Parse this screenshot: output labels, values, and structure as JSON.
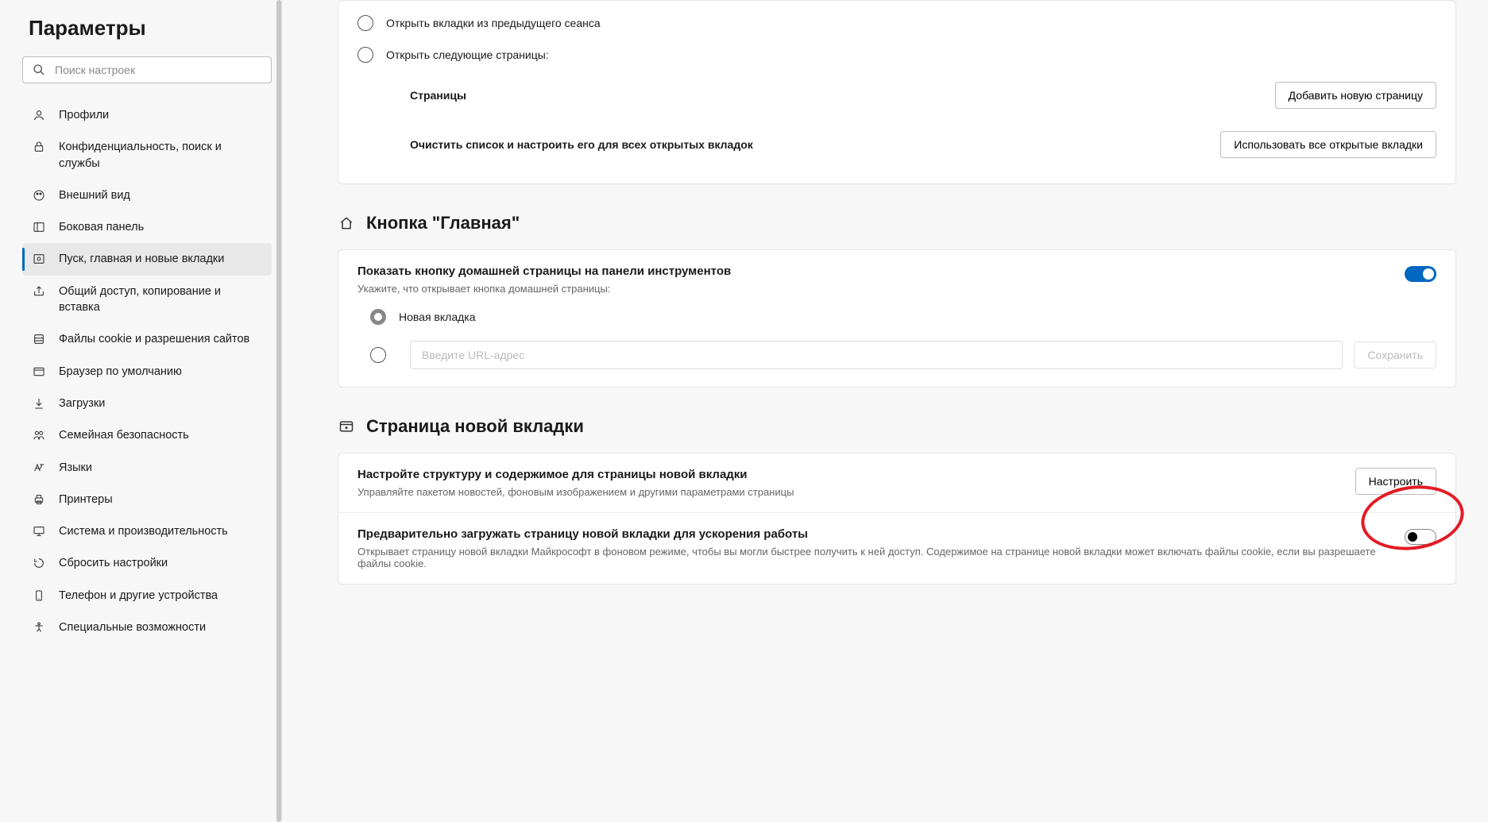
{
  "sidebar": {
    "title": "Параметры",
    "search_placeholder": "Поиск настроек",
    "items": [
      {
        "label": "Профили"
      },
      {
        "label": "Конфиденциальность, поиск и службы"
      },
      {
        "label": "Внешний вид"
      },
      {
        "label": "Боковая панель"
      },
      {
        "label": "Пуск, главная и новые вкладки"
      },
      {
        "label": "Общий доступ, копирование и вставка"
      },
      {
        "label": "Файлы cookie и разрешения сайтов"
      },
      {
        "label": "Браузер по умолчанию"
      },
      {
        "label": "Загрузки"
      },
      {
        "label": "Семейная безопасность"
      },
      {
        "label": "Языки"
      },
      {
        "label": "Принтеры"
      },
      {
        "label": "Система и производительность"
      },
      {
        "label": "Сбросить настройки"
      },
      {
        "label": "Телефон и другие устройства"
      },
      {
        "label": "Специальные возможности"
      }
    ]
  },
  "startup": {
    "radio_prev_session": "Открыть вкладки из предыдущего сеанса",
    "radio_specific": "Открыть следующие страницы:",
    "pages_label": "Страницы",
    "add_page_btn": "Добавить новую страницу",
    "clear_label": "Очистить список и настроить его для всех открытых вкладок",
    "use_open_btn": "Использовать все открытые вкладки"
  },
  "home": {
    "heading": "Кнопка \"Главная\"",
    "show_button_title": "Показать кнопку домашней страницы на панели инструментов",
    "show_button_desc": "Укажите, что открывает кнопка домашней страницы:",
    "radio_newtab": "Новая вкладка",
    "url_placeholder": "Введите URL-адрес",
    "save_btn": "Сохранить"
  },
  "newtab": {
    "heading": "Страница новой вкладки",
    "customize_title": "Настройте структуру и содержимое для страницы новой вкладки",
    "customize_desc": "Управляйте пакетом новостей, фоновым изображением и другими параметрами страницы",
    "customize_btn": "Настроить",
    "preload_title": "Предварительно загружать страницу новой вкладки для ускорения работы",
    "preload_desc": "Открывает страницу новой вкладки Майкрософт в фоновом режиме, чтобы вы могли быстрее получить к ней доступ. Содержимое на странице новой вкладки может включать файлы cookie, если вы разрешаете файлы cookie."
  }
}
